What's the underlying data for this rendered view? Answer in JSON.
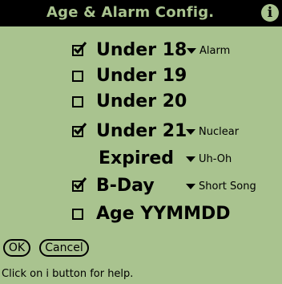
{
  "title": "Age & Alarm Config.",
  "info_button": "i",
  "rows": [
    {
      "label": "Under 18",
      "checked": true,
      "has_checkbox": true,
      "dropdown": "Alarm"
    },
    {
      "label": "Under 19",
      "checked": false,
      "has_checkbox": true,
      "dropdown": null
    },
    {
      "label": "Under 20",
      "checked": false,
      "has_checkbox": true,
      "dropdown": null
    },
    {
      "label": "Under 21",
      "checked": true,
      "has_checkbox": true,
      "dropdown": "Nuclear"
    },
    {
      "label": "Expired",
      "checked": false,
      "has_checkbox": false,
      "dropdown": "Uh-Oh"
    },
    {
      "label": "B-Day",
      "checked": true,
      "has_checkbox": true,
      "dropdown": "Short Song"
    },
    {
      "label": "Age YYMMDD",
      "checked": false,
      "has_checkbox": true,
      "dropdown": null
    }
  ],
  "buttons": {
    "ok": "OK",
    "cancel": "Cancel"
  },
  "status": "Click on i button for help.",
  "colors": {
    "background": "#a9c38f",
    "foreground": "#000000"
  },
  "icons": {
    "info": "info-icon",
    "dropdown": "triangle-down-icon",
    "checkmark": "checkmark-icon"
  }
}
